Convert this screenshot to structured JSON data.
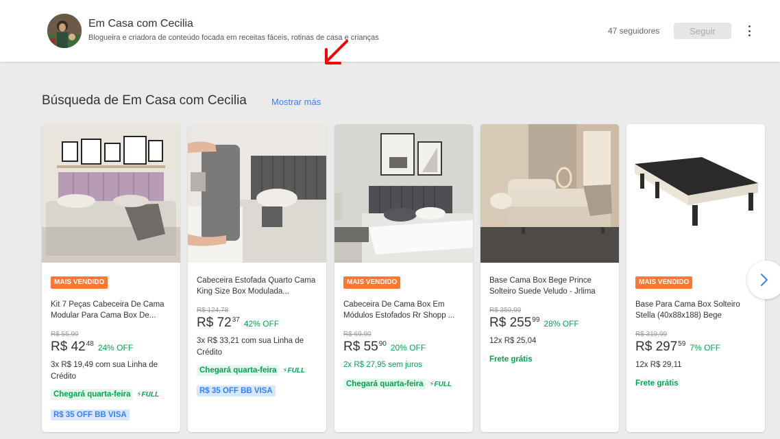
{
  "profile": {
    "name": "Em Casa com Cecilia",
    "description": "Blogueira e criadora de conteúdo focada em receitas fáceis, rotinas de casa e crianças",
    "followers": "47 seguidores",
    "follow_label": "Seguir"
  },
  "section": {
    "title": "Búsqueda de Em Casa com Cecilia",
    "show_more": "Mostrar más"
  },
  "colors": {
    "accent_blue": "#3483fa",
    "discount_green": "#00a650",
    "badge_orange": "#ff7733",
    "annotation_red": "#ff0000"
  },
  "products": [
    {
      "badge": "MAIS VENDIDO",
      "title": "Kit 7 Peças Cabeceira De Cama Modular Para Cama Box De...",
      "old_price": "R$ 55,90",
      "price": "R$ 42",
      "cents": "48",
      "discount": "24% OFF",
      "installments": "3x R$ 19,49 com sua Linha de Crédito",
      "shipping": "Chegará quarta-feira",
      "full": "FULL",
      "promo": "R$ 35 OFF BB VISA"
    },
    {
      "badge": "",
      "title": "Cabeceira Estofada Quarto Cama King Size Box Modulada...",
      "old_price": "R$ 124,78",
      "price": "R$ 72",
      "cents": "37",
      "discount": "42% OFF",
      "installments": "3x R$ 33,21 com sua Linha de Crédito",
      "shipping": "Chegará quarta-feira",
      "full": "FULL",
      "promo": "R$ 35 OFF BB VISA"
    },
    {
      "badge": "MAIS VENDIDO",
      "title": "Cabeceira De Cama Box Em Módulos Estofados Rr Shopp ...",
      "old_price": "R$ 69,90",
      "price": "R$ 55",
      "cents": "90",
      "discount": "20% OFF",
      "installments": "2x R$ 27,95 sem juros",
      "shipping": "Chegará quarta-feira",
      "full": "FULL",
      "promo": ""
    },
    {
      "badge": "",
      "title": "Base Cama Box Bege Prince Solteiro Suede Veludo - Jrlima",
      "old_price": "R$ 359,99",
      "price": "R$ 255",
      "cents": "99",
      "discount": "28% OFF",
      "installments": "12x R$ 25,04",
      "free_shipping": "Frete grátis"
    },
    {
      "badge": "MAIS VENDIDO",
      "title": "Base Para Cama Box Solteiro Stella (40x88x188) Bege",
      "old_price": "R$ 319,99",
      "price": "R$ 297",
      "cents": "59",
      "discount": "7% OFF",
      "installments": "12x R$ 29,11",
      "free_shipping": "Frete grátis"
    }
  ],
  "icons": {
    "kebab": "more-vert-icon",
    "next": "chevron-right-icon",
    "full": "lightning-icon"
  }
}
